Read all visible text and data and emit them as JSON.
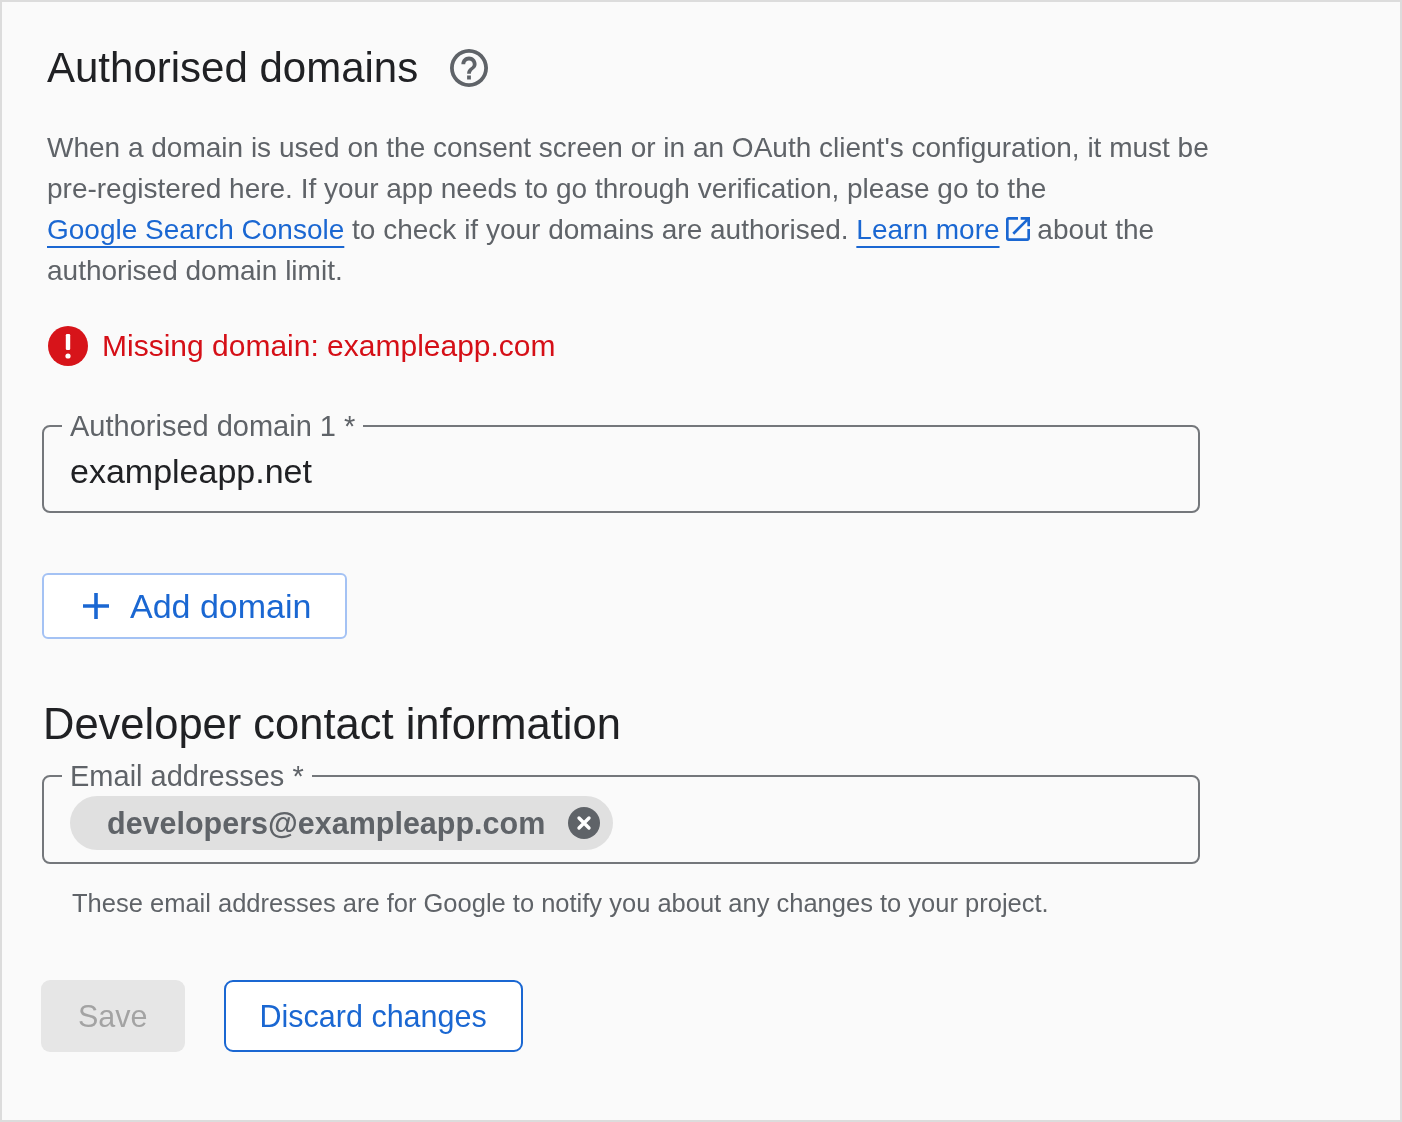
{
  "authorised_domains": {
    "title": "Authorised domains",
    "description": [
      {
        "kind": "text",
        "text": "When a domain is used on the consent screen or in an OAuth client's configuration, it must be pre-registered here. If your app needs to go through verification, please go to the "
      },
      {
        "kind": "link",
        "text": "Google Search Console"
      },
      {
        "kind": "text",
        "text": " to check if your domains are authorised. "
      },
      {
        "kind": "external_link",
        "text": "Learn more"
      },
      {
        "kind": "text",
        "text": " about the authorised domain limit."
      }
    ],
    "error": {
      "text": "Missing domain: exampleapp.com"
    },
    "fields": [
      {
        "label": "Authorised domain 1 *",
        "value": "exampleapp.net"
      }
    ],
    "add_button": {
      "label": "Add domain"
    }
  },
  "developer_contact": {
    "title": "Developer contact information",
    "email_field": {
      "label": "Email addresses *",
      "chips": [
        {
          "text": "developers@exampleapp.com"
        }
      ]
    },
    "helper": "These email addresses are for Google to notify you about any changes to your project."
  },
  "actions": [
    {
      "kind": "filled",
      "label": "Save",
      "disabled": true
    },
    {
      "kind": "outlined",
      "label": "Discard changes",
      "disabled": false
    }
  ]
}
